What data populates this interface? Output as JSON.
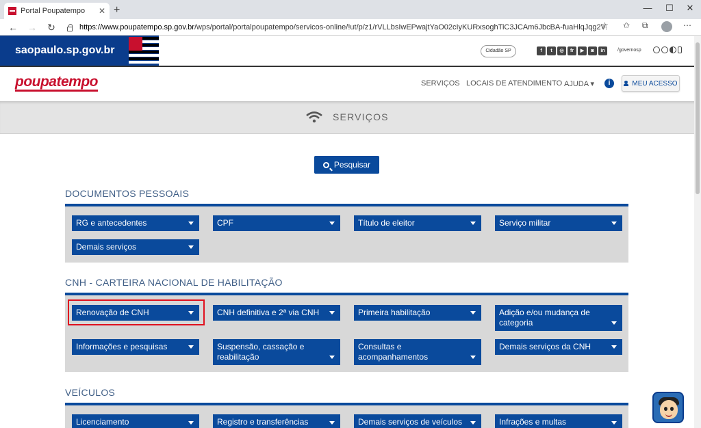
{
  "browser": {
    "tab_title": "Portal Poupatempo",
    "tab_close": "✕",
    "new_tab": "+",
    "url_host": "https://www.poupatempo.sp.gov.br",
    "url_path": "/wps/portal/portalpoupatempo/servicos-online/!ut/p/z1/rVLLbsIwEPwajtYaO02cIyKURxsoghTiC3JCAm6JbcBA-fuaHlqJqg2V...",
    "window_controls": {
      "minimize": "—",
      "maximize": "☐",
      "close": "✕"
    },
    "icons": [
      "back-icon",
      "forward-icon",
      "reload-icon",
      "star-icon",
      "favorites-icon",
      "collections-icon",
      "profile-icon",
      "more-icon"
    ]
  },
  "gov_bar": {
    "logo_text": "saopaulo.sp.gov.br",
    "cidadao_label": "Cidadão SP",
    "social": [
      "f",
      "t",
      "◎",
      "fr",
      "▶",
      "◙",
      "in"
    ],
    "handle": "/governosp"
  },
  "header": {
    "brand": "poupatempo",
    "nav": [
      "SERVIÇOS",
      "LOCAIS DE ATENDIMENTO",
      "AJUDA ▾"
    ],
    "info_label": "i",
    "login_label": "MEU ACESSO"
  },
  "banner": {
    "title": "SERVIÇOS"
  },
  "search": {
    "label": "Pesquisar"
  },
  "sections": [
    {
      "title": "DOCUMENTOS PESSOAIS",
      "items": [
        "RG e antecedentes",
        "CPF",
        "Título de eleitor",
        "Serviço militar",
        "Demais serviços"
      ]
    },
    {
      "title": "CNH - CARTEIRA NACIONAL DE HABILITAÇÃO",
      "items": [
        "Renovação de CNH",
        "CNH definitiva e 2ª via CNH",
        "Primeira habilitação",
        "Adição e/ou mudança de categoria",
        "Informações e pesquisas",
        "Suspensão, cassação e reabilitação",
        "Consultas e acompanhamentos",
        "Demais serviços da CNH"
      ]
    },
    {
      "title": "VEÍCULOS",
      "items": [
        "Licenciamento",
        "Registro e transferências",
        "Demais serviços de veículos",
        "Infrações e multas"
      ]
    }
  ],
  "colors": {
    "primary": "#0a4a9c",
    "brand_red": "#c8102e",
    "highlight": "#e0101e",
    "panel_bg": "#d8d8d8"
  }
}
